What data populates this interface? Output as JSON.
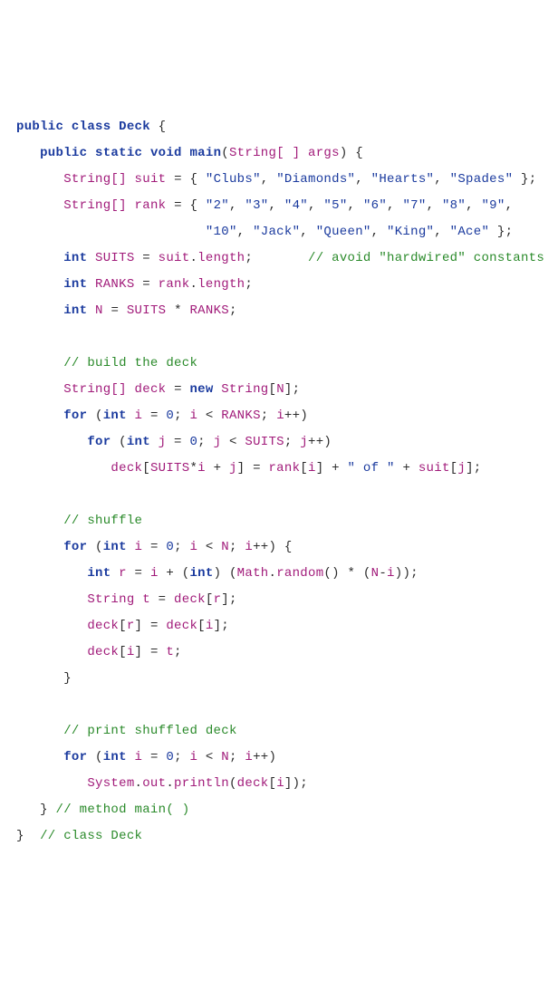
{
  "code": {
    "keywords": {
      "public": "public",
      "class": "class",
      "static": "static",
      "void": "void",
      "int": "int",
      "for": "for",
      "new": "new"
    },
    "types": {
      "String": "String",
      "StringArr": "String[]",
      "StringArrSpc": "String[ ]",
      "Math": "Math",
      "System": "System"
    },
    "identifiers": {
      "Deck": "Deck",
      "main": "main",
      "args": "args",
      "suit": "suit",
      "rank": "rank",
      "SUITS": "SUITS",
      "RANKS": "RANKS",
      "N": "N",
      "deck": "deck",
      "i": "i",
      "j": "j",
      "r": "r",
      "t": "t",
      "length": "length",
      "random": "random",
      "out": "out",
      "println": "println"
    },
    "strings": {
      "Clubs": "\"Clubs\"",
      "Diamonds": "\"Diamonds\"",
      "Hearts": "\"Hearts\"",
      "Spades": "\"Spades\"",
      "r2": "\"2\"",
      "r3": "\"3\"",
      "r4": "\"4\"",
      "r5": "\"5\"",
      "r6": "\"6\"",
      "r7": "\"7\"",
      "r8": "\"8\"",
      "r9": "\"9\"",
      "r10": "\"10\"",
      "Jack": "\"Jack\"",
      "Queen": "\"Queen\"",
      "King": "\"King\"",
      "Ace": "\"Ace\"",
      "of": "\" of \""
    },
    "numbers": {
      "zero": "0"
    },
    "comments": {
      "hardwired": "// avoid \"hardwired\" constants",
      "build": "// build the deck",
      "shuffle": "// shuffle",
      "print": "// print shuffled deck",
      "methodMain": "// method main( )",
      "classDeck": "// class Deck"
    },
    "symbols": {
      "lbrace": "{",
      "rbrace": "}",
      "lparen": "(",
      "rparen": ")",
      "lbrack": "[",
      "rbrack": "]",
      "semi": ";",
      "comma": ",",
      "eq": "=",
      "lt": "<",
      "plus": "+",
      "minus": "-",
      "star": "*",
      "dot": ".",
      "inc": "++"
    }
  }
}
